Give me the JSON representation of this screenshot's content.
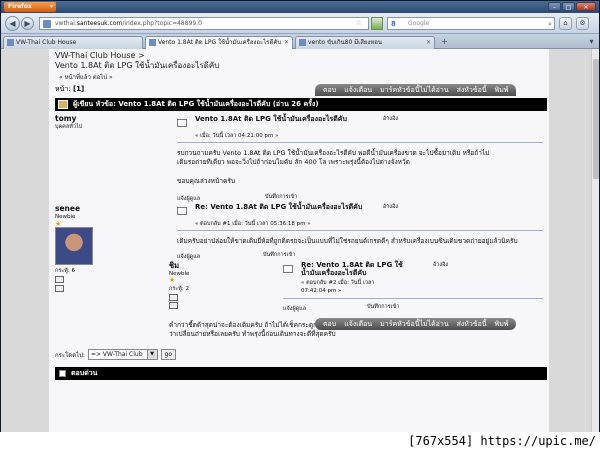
{
  "browser": {
    "menu_label": "Firefox",
    "url_prefix": "vwthai.",
    "url_domain": "santeesuk.com",
    "url_path": "/index.php?topic=48899.0",
    "search_placeholder": "Google",
    "tabs": [
      {
        "label": "VW-Thai Club House"
      },
      {
        "label": "Vento 1.8At ติด LPG ใช้น้ำมันเครื่องอะไรดีคับ"
      },
      {
        "label": "vento ขับเกิน80 มีเสียงหอน"
      }
    ]
  },
  "forum": {
    "breadcrumb_home": "VW-Thai Club House >",
    "breadcrumb_topic": "Vento 1.8At ติด LPG ใช้น้ำมันเครื่องอะไรดีคับ",
    "prev_next": "« หน้าที่แล้ว ต่อไป »",
    "pages_label": "หน้า:",
    "current_page": "[1]",
    "actions": [
      "ตอบ",
      "แจ้งเตือน",
      "มาร์คหัวข้อนี้ไม่ได้อ่าน",
      "ส่งหัวข้อนี้",
      "พิมพ์"
    ],
    "topic_header": "ผู้เขียน หัวข้อ: Vento 1.8At ติด LPG ใช้น้ำมันเครื่องอะไรดีคับ  (อ่าน 26 ครั้ง)",
    "quote_label": "อ้างอิง",
    "report_label": "แจ้งผู้ดูแล",
    "logged_label": "บันทึกการเข้า"
  },
  "posts": [
    {
      "author": "tomy",
      "rank": "บุคคลทั่วไป",
      "title": "Vento 1.8At ติด LPG ใช้น้ำมันเครื่องอะไรดีคับ",
      "date": "« เมื่อ: วันนี้ เวลา 04:21:00 pm »",
      "body_1": "รบกวนถามครับ Vento 1.8At ติด LPG ใช้น้ำมันเครื่องอะไรดีคับ พอดีน้ำมันเครื่องขาด จะไปซื้อมาเติม หรือถ้าไม่",
      "body_2": "เติมรอถ่ายทีเดียว พอจะวิ่งไปถ้าก่อนไมคับ สัก 400 โล เพราะพรุ่งนี้ต้องไปต่างจังหวัด",
      "body_3": "ขอบคุณล่วงหน้าครับ",
      "report": "แจ้งผู้ดูแล"
    },
    {
      "author": "senee",
      "rank": "Newbie",
      "posts_count": "กระทู้: 6",
      "title": "Re: Vento 1.8At ติด LPG ใช้น้ำมันเครื่องอะไรดีคับ",
      "date": "« ตอบกลับ #1 เมื่อ: วันนี้ เวลา 05:36:18 pm »",
      "body_1": "เติมครับอย่าปล่อยให้ขาดเติมยี่ห้อที่ถูกติดรถจะเป็นแบบที่ไม่ใช่รถยนต์เกรดดีๆ สำหรับเครื่องเบนซินเติมขวดถ่ายอยู่แล้วนิครับ",
      "report": "แจ้งผู้ดูแล"
    },
    {
      "author": "ชิม",
      "rank": "Newbie",
      "posts_count": "กระทู้: 2",
      "title": "Re: Vento 1.8At ติด LPG ใช้น้ำมันเครื่องอะไรดีคับ",
      "date": "« ตอบกลับ #2 เมื่อ: วันนี้ เวลา",
      "time": "07:42:04 pm »",
      "body_1": "คำกว่าชี้ตด้าสุดน่าจะต้องเติมครับ ถ้าไม่ได้เช็คกระดูกไฟส่วนไหนเราก็ทำให้ต้องเสียอีกเนื่องครับ",
      "body_2": "ว่าเปลี่ยนถ่ายหรือเลยครับ ทำพรุ่งนี้ก่อนเดินทางจะดีที่สุดครับ",
      "report": "แจ้งผู้ดูแล"
    }
  ],
  "footer": {
    "jump_label": "กระโดดไป:",
    "jump_value": "=> VW-Thai Club",
    "go_label": "go",
    "quick_reply": "ตอบด่วน"
  },
  "watermark": "[767x554] https://upic.me/"
}
